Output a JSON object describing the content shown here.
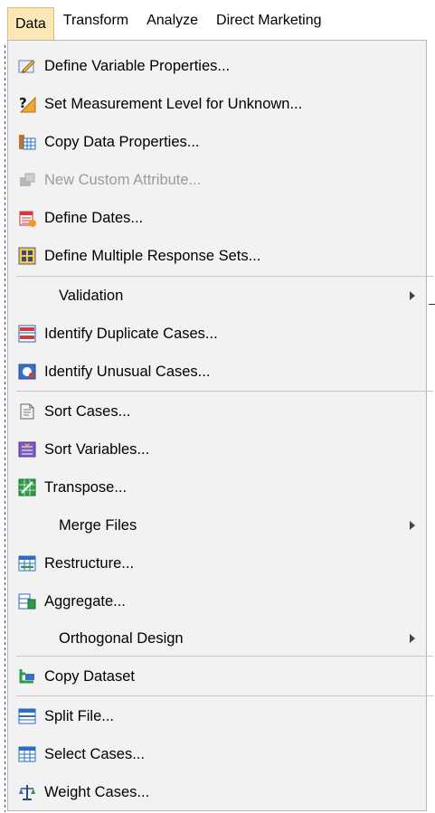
{
  "menubar": {
    "items": [
      {
        "label": "Data"
      },
      {
        "label": "Transform"
      },
      {
        "label": "Analyze"
      },
      {
        "label": "Direct Marketing"
      }
    ]
  },
  "menu": {
    "items": [
      {
        "label": "Define Variable Properties...",
        "icon": "define-variable-icon"
      },
      {
        "label": "Set Measurement Level for Unknown...",
        "icon": "measurement-level-icon"
      },
      {
        "label": "Copy Data Properties...",
        "icon": "copy-properties-icon"
      },
      {
        "label": "New Custom Attribute...",
        "icon": "custom-attribute-icon",
        "disabled": true
      },
      {
        "label": "Define Dates...",
        "icon": "calendar-icon"
      },
      {
        "label": "Define Multiple Response Sets...",
        "icon": "response-sets-icon"
      },
      {
        "label": "Validation",
        "submenu": true
      },
      {
        "label": "Identify Duplicate Cases...",
        "icon": "duplicate-cases-icon"
      },
      {
        "label": "Identify Unusual Cases...",
        "icon": "unusual-cases-icon"
      },
      {
        "label": "Sort Cases...",
        "icon": "sort-cases-icon"
      },
      {
        "label": "Sort Variables...",
        "icon": "sort-variables-icon"
      },
      {
        "label": "Transpose...",
        "icon": "transpose-icon"
      },
      {
        "label": "Merge Files",
        "submenu": true
      },
      {
        "label": "Restructure...",
        "icon": "restructure-icon"
      },
      {
        "label": "Aggregate...",
        "icon": "aggregate-icon"
      },
      {
        "label": "Orthogonal Design",
        "submenu": true
      },
      {
        "label": "Copy Dataset",
        "icon": "copy-dataset-icon"
      },
      {
        "label": "Split File...",
        "icon": "split-file-icon"
      },
      {
        "label": "Select Cases...",
        "icon": "select-cases-icon"
      },
      {
        "label": "Weight Cases...",
        "icon": "scale-icon"
      }
    ]
  },
  "colors": {
    "menu_bg": "#f2f2f2",
    "active_tab": "#fbe7b8",
    "disabled_text": "#9b9b9b"
  }
}
